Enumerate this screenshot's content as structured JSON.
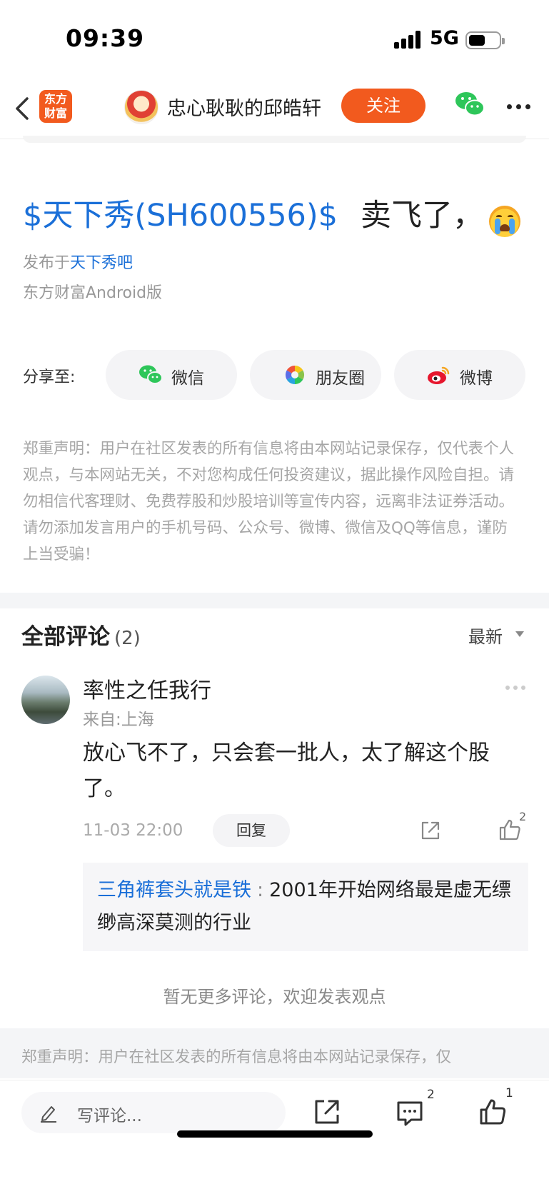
{
  "status_bar": {
    "time": "09:39",
    "network": "5G"
  },
  "nav": {
    "app_logo_line1": "东方",
    "app_logo_line2": "财富",
    "author_name": "忠心耿耿的邱皓轩",
    "follow_label": "关注"
  },
  "post": {
    "stock_tag": "$天下秀(SH600556)$",
    "text": "卖飞了，",
    "emoji": "crying-face",
    "published_prefix": "发布于",
    "published_forum": "天下秀吧",
    "source": "东方财富Android版"
  },
  "share": {
    "label": "分享至:",
    "targets": [
      {
        "label": "微信",
        "icon": "wechat-icon"
      },
      {
        "label": "朋友圈",
        "icon": "moments-icon"
      },
      {
        "label": "微博",
        "icon": "weibo-icon"
      }
    ]
  },
  "disclaimer": "郑重声明：用户在社区发表的所有信息将由本网站记录保存，仅代表个人观点，与本网站无关，不对您构成任何投资建议，据此操作风险自担。请勿相信代客理财、免费荐股和炒股培训等宣传内容，远离非法证券活动。请勿添加发言用户的手机号码、公众号、微博、微信及QQ等信息，谨防上当受骗！",
  "comments": {
    "title": "全部评论",
    "count": "(2)",
    "sort_label": "最新",
    "items": [
      {
        "user": "率性之任我行",
        "location": "来自:上海",
        "text": "放心飞不了，只会套一批人，太了解这个股了。",
        "time": "11-03 22:00",
        "reply_label": "回复",
        "likes": "2",
        "reply": {
          "user": "三角裤套头就是铁",
          "colon": ":",
          "text": "2001年开始网络最是虚无缥缈高深莫测的行业"
        }
      }
    ],
    "no_more": "暂无更多评论，欢迎发表观点"
  },
  "footer_disclaimer": "郑重声明：用户在社区发表的所有信息将由本网站记录保存，仅",
  "bottom_bar": {
    "placeholder": "写评论...",
    "comment_count": "2",
    "like_count": "1"
  },
  "colors": {
    "accent": "#f25a1e",
    "link": "#1a6fd8"
  }
}
